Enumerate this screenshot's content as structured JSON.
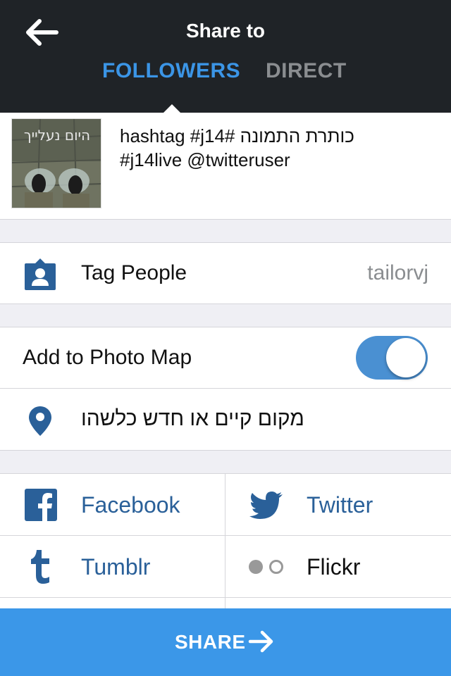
{
  "header": {
    "title": "Share to",
    "tabs": {
      "followers": "FOLLOWERS",
      "direct": "DIRECT"
    }
  },
  "post": {
    "caption_line1": "כותרת התמונה #hashtag #j14",
    "caption_line2": "#j14live @twitteruser",
    "thumbnail_text": "היום נעלייך"
  },
  "tag_people": {
    "label": "Tag People",
    "value": "tailorvj"
  },
  "photo_map": {
    "label": "Add to Photo Map",
    "enabled": true
  },
  "location": {
    "placeholder": "מקום קיים או חדש כלשהו"
  },
  "services": {
    "facebook": "Facebook",
    "twitter": "Twitter",
    "tumblr": "Tumblr",
    "flickr": "Flickr"
  },
  "share_button": {
    "label": "SHARE"
  },
  "colors": {
    "header_bg": "#1f2327",
    "accent": "#3b95e6",
    "service_text": "#2a6099",
    "share_bg": "#3b97e8"
  }
}
